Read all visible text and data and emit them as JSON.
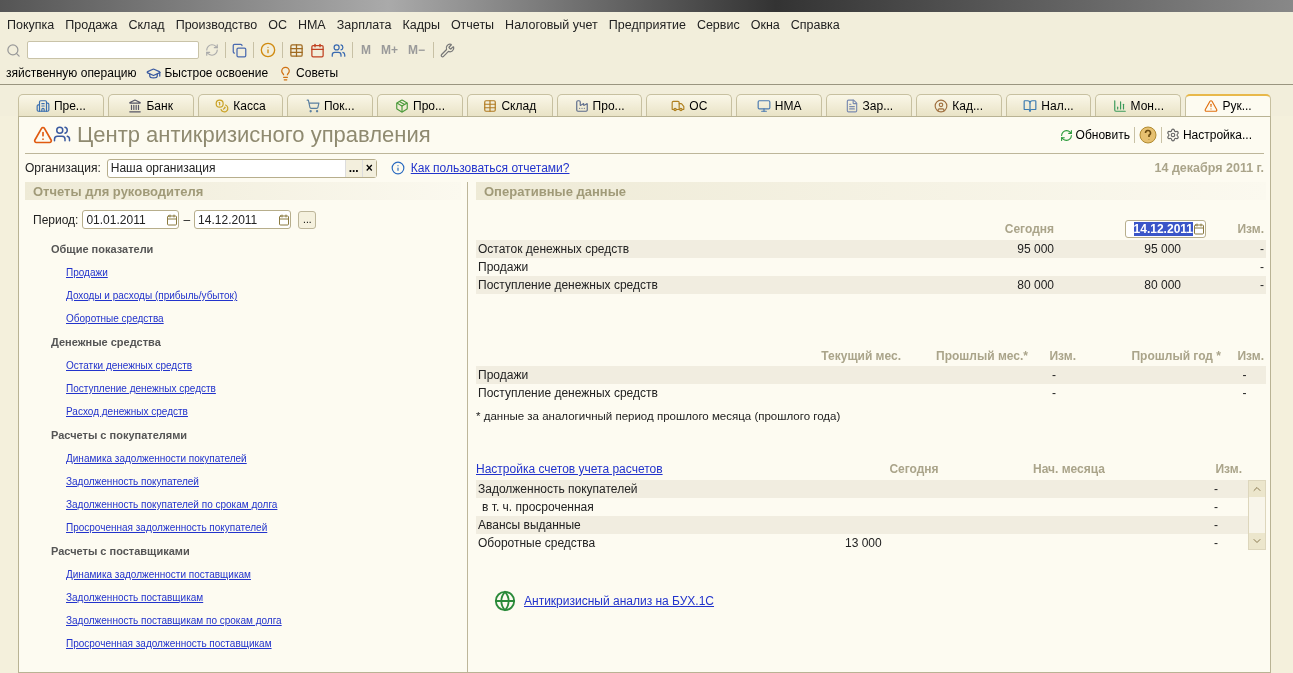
{
  "menu": [
    "Покупка",
    "Продажа",
    "Склад",
    "Производство",
    "ОС",
    "НМА",
    "Зарплата",
    "Кадры",
    "Отчеты",
    "Налоговый учет",
    "Предприятие",
    "Сервис",
    "Окна",
    "Справка"
  ],
  "toolbar": {
    "memory_buttons": [
      "M",
      "M+",
      "M−"
    ]
  },
  "quick_bar": [
    "зяйственную операцию",
    "Быстрое освоение",
    "Советы"
  ],
  "tabs": [
    {
      "label": "Пре...",
      "selected": false
    },
    {
      "label": "Банк",
      "selected": false
    },
    {
      "label": "Касса",
      "selected": false
    },
    {
      "label": "Пок...",
      "selected": false
    },
    {
      "label": "Про...",
      "selected": false
    },
    {
      "label": "Склад",
      "selected": false
    },
    {
      "label": "Про...",
      "selected": false
    },
    {
      "label": "ОС",
      "selected": false
    },
    {
      "label": "НМА",
      "selected": false
    },
    {
      "label": "Зар...",
      "selected": false
    },
    {
      "label": "Кад...",
      "selected": false
    },
    {
      "label": "Нал...",
      "selected": false
    },
    {
      "label": "Мон...",
      "selected": false
    },
    {
      "label": "Рук...",
      "selected": true
    }
  ],
  "page": {
    "title": "Центр антикризисного управления",
    "refresh": "Обновить",
    "settings": "Настройка...",
    "organization": {
      "label": "Организация:",
      "value": "Наша организация",
      "choose": "...",
      "clear": "×"
    },
    "help_link": "Как пользоваться отчетами?",
    "date": "14 декабря 2011 г."
  },
  "reports": {
    "title": "Отчеты для руководителя",
    "period_label": "Период:",
    "from": "01.01.2011",
    "separator": "–",
    "to": "14.12.2011",
    "more": "...",
    "groups": [
      {
        "title": "Общие показатели",
        "links": [
          "Продажи",
          "Доходы и расходы (прибыль/убыток)",
          "Оборотные средства"
        ]
      },
      {
        "title": "Денежные средства",
        "links": [
          "Остатки денежных средств",
          "Поступление денежных средств",
          "Расход денежных средств"
        ]
      },
      {
        "title": "Расчеты с покупателями",
        "links": [
          "Динамика задолженности покупателей",
          "Задолженность покупателей",
          "Задолженность покупателей по срокам долга",
          "Просроченная задолженность покупателей"
        ]
      },
      {
        "title": "Расчеты с поставщиками",
        "links": [
          "Динамика задолженности поставщикам",
          "Задолженность поставщикам",
          "Задолженность поставщикам по срокам долга",
          "Просроченная задолженность поставщикам"
        ]
      }
    ]
  },
  "operational": {
    "title": "Оперативные данные",
    "summary": {
      "today": "Сегодня",
      "date_field": "14.12.2011",
      "change": "Изм.",
      "rows": [
        {
          "label": "Остаток денежных средств",
          "cells": [
            "95 000",
            "95 000",
            "-"
          ]
        },
        {
          "label": "Продажи",
          "cells": [
            null,
            null,
            "-"
          ]
        },
        {
          "label": "Поступление денежных средств",
          "cells": [
            "80 000",
            "80 000",
            "-"
          ]
        }
      ]
    },
    "comparison": {
      "columns": [
        "Текущий мес.",
        "Прошлый мес.*",
        "Изм.",
        "Прошлый год *",
        "Изм."
      ],
      "rows": [
        {
          "label": "Продажи",
          "cells": [
            null,
            null,
            "-",
            null,
            "-"
          ]
        },
        {
          "label": "Поступление денежных средств",
          "cells": [
            null,
            null,
            "-",
            null,
            "-"
          ]
        }
      ],
      "footnote": "* данные за аналогичный период прошлого месяца (прошлого года)"
    },
    "settlements": {
      "link": "Настройка счетов учета расчетов",
      "columns": [
        "Сегодня",
        "Нач. месяца",
        "Изм."
      ],
      "rows": [
        {
          "label": "Задолженность покупателей",
          "kind": "main",
          "cells": [
            null,
            null,
            "-"
          ]
        },
        {
          "label": "в т. ч. просроченная",
          "kind": "sub",
          "cells": [
            null,
            null,
            "-"
          ]
        },
        {
          "label": "Авансы выданные",
          "kind": "main",
          "cells": [
            null,
            null,
            "-"
          ]
        },
        {
          "label": "Оборотные средства",
          "kind": "main",
          "cells": [
            "13 000",
            null,
            "-"
          ]
        }
      ]
    },
    "analysis_link": "Антикризисный анализ на БУХ.1С"
  }
}
